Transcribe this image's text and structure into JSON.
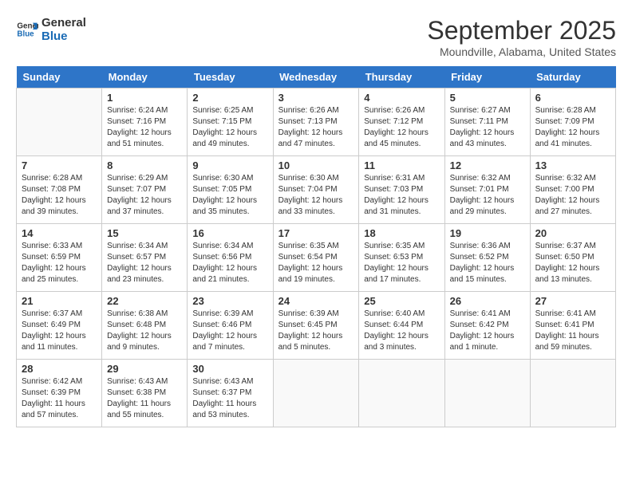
{
  "header": {
    "logo_line1": "General",
    "logo_line2": "Blue",
    "month": "September 2025",
    "location": "Moundville, Alabama, United States"
  },
  "days_of_week": [
    "Sunday",
    "Monday",
    "Tuesday",
    "Wednesday",
    "Thursday",
    "Friday",
    "Saturday"
  ],
  "weeks": [
    [
      {
        "day": "",
        "info": ""
      },
      {
        "day": "1",
        "info": "Sunrise: 6:24 AM\nSunset: 7:16 PM\nDaylight: 12 hours\nand 51 minutes."
      },
      {
        "day": "2",
        "info": "Sunrise: 6:25 AM\nSunset: 7:15 PM\nDaylight: 12 hours\nand 49 minutes."
      },
      {
        "day": "3",
        "info": "Sunrise: 6:26 AM\nSunset: 7:13 PM\nDaylight: 12 hours\nand 47 minutes."
      },
      {
        "day": "4",
        "info": "Sunrise: 6:26 AM\nSunset: 7:12 PM\nDaylight: 12 hours\nand 45 minutes."
      },
      {
        "day": "5",
        "info": "Sunrise: 6:27 AM\nSunset: 7:11 PM\nDaylight: 12 hours\nand 43 minutes."
      },
      {
        "day": "6",
        "info": "Sunrise: 6:28 AM\nSunset: 7:09 PM\nDaylight: 12 hours\nand 41 minutes."
      }
    ],
    [
      {
        "day": "7",
        "info": "Sunrise: 6:28 AM\nSunset: 7:08 PM\nDaylight: 12 hours\nand 39 minutes."
      },
      {
        "day": "8",
        "info": "Sunrise: 6:29 AM\nSunset: 7:07 PM\nDaylight: 12 hours\nand 37 minutes."
      },
      {
        "day": "9",
        "info": "Sunrise: 6:30 AM\nSunset: 7:05 PM\nDaylight: 12 hours\nand 35 minutes."
      },
      {
        "day": "10",
        "info": "Sunrise: 6:30 AM\nSunset: 7:04 PM\nDaylight: 12 hours\nand 33 minutes."
      },
      {
        "day": "11",
        "info": "Sunrise: 6:31 AM\nSunset: 7:03 PM\nDaylight: 12 hours\nand 31 minutes."
      },
      {
        "day": "12",
        "info": "Sunrise: 6:32 AM\nSunset: 7:01 PM\nDaylight: 12 hours\nand 29 minutes."
      },
      {
        "day": "13",
        "info": "Sunrise: 6:32 AM\nSunset: 7:00 PM\nDaylight: 12 hours\nand 27 minutes."
      }
    ],
    [
      {
        "day": "14",
        "info": "Sunrise: 6:33 AM\nSunset: 6:59 PM\nDaylight: 12 hours\nand 25 minutes."
      },
      {
        "day": "15",
        "info": "Sunrise: 6:34 AM\nSunset: 6:57 PM\nDaylight: 12 hours\nand 23 minutes."
      },
      {
        "day": "16",
        "info": "Sunrise: 6:34 AM\nSunset: 6:56 PM\nDaylight: 12 hours\nand 21 minutes."
      },
      {
        "day": "17",
        "info": "Sunrise: 6:35 AM\nSunset: 6:54 PM\nDaylight: 12 hours\nand 19 minutes."
      },
      {
        "day": "18",
        "info": "Sunrise: 6:35 AM\nSunset: 6:53 PM\nDaylight: 12 hours\nand 17 minutes."
      },
      {
        "day": "19",
        "info": "Sunrise: 6:36 AM\nSunset: 6:52 PM\nDaylight: 12 hours\nand 15 minutes."
      },
      {
        "day": "20",
        "info": "Sunrise: 6:37 AM\nSunset: 6:50 PM\nDaylight: 12 hours\nand 13 minutes."
      }
    ],
    [
      {
        "day": "21",
        "info": "Sunrise: 6:37 AM\nSunset: 6:49 PM\nDaylight: 12 hours\nand 11 minutes."
      },
      {
        "day": "22",
        "info": "Sunrise: 6:38 AM\nSunset: 6:48 PM\nDaylight: 12 hours\nand 9 minutes."
      },
      {
        "day": "23",
        "info": "Sunrise: 6:39 AM\nSunset: 6:46 PM\nDaylight: 12 hours\nand 7 minutes."
      },
      {
        "day": "24",
        "info": "Sunrise: 6:39 AM\nSunset: 6:45 PM\nDaylight: 12 hours\nand 5 minutes."
      },
      {
        "day": "25",
        "info": "Sunrise: 6:40 AM\nSunset: 6:44 PM\nDaylight: 12 hours\nand 3 minutes."
      },
      {
        "day": "26",
        "info": "Sunrise: 6:41 AM\nSunset: 6:42 PM\nDaylight: 12 hours\nand 1 minute."
      },
      {
        "day": "27",
        "info": "Sunrise: 6:41 AM\nSunset: 6:41 PM\nDaylight: 11 hours\nand 59 minutes."
      }
    ],
    [
      {
        "day": "28",
        "info": "Sunrise: 6:42 AM\nSunset: 6:39 PM\nDaylight: 11 hours\nand 57 minutes."
      },
      {
        "day": "29",
        "info": "Sunrise: 6:43 AM\nSunset: 6:38 PM\nDaylight: 11 hours\nand 55 minutes."
      },
      {
        "day": "30",
        "info": "Sunrise: 6:43 AM\nSunset: 6:37 PM\nDaylight: 11 hours\nand 53 minutes."
      },
      {
        "day": "",
        "info": ""
      },
      {
        "day": "",
        "info": ""
      },
      {
        "day": "",
        "info": ""
      },
      {
        "day": "",
        "info": ""
      }
    ]
  ]
}
